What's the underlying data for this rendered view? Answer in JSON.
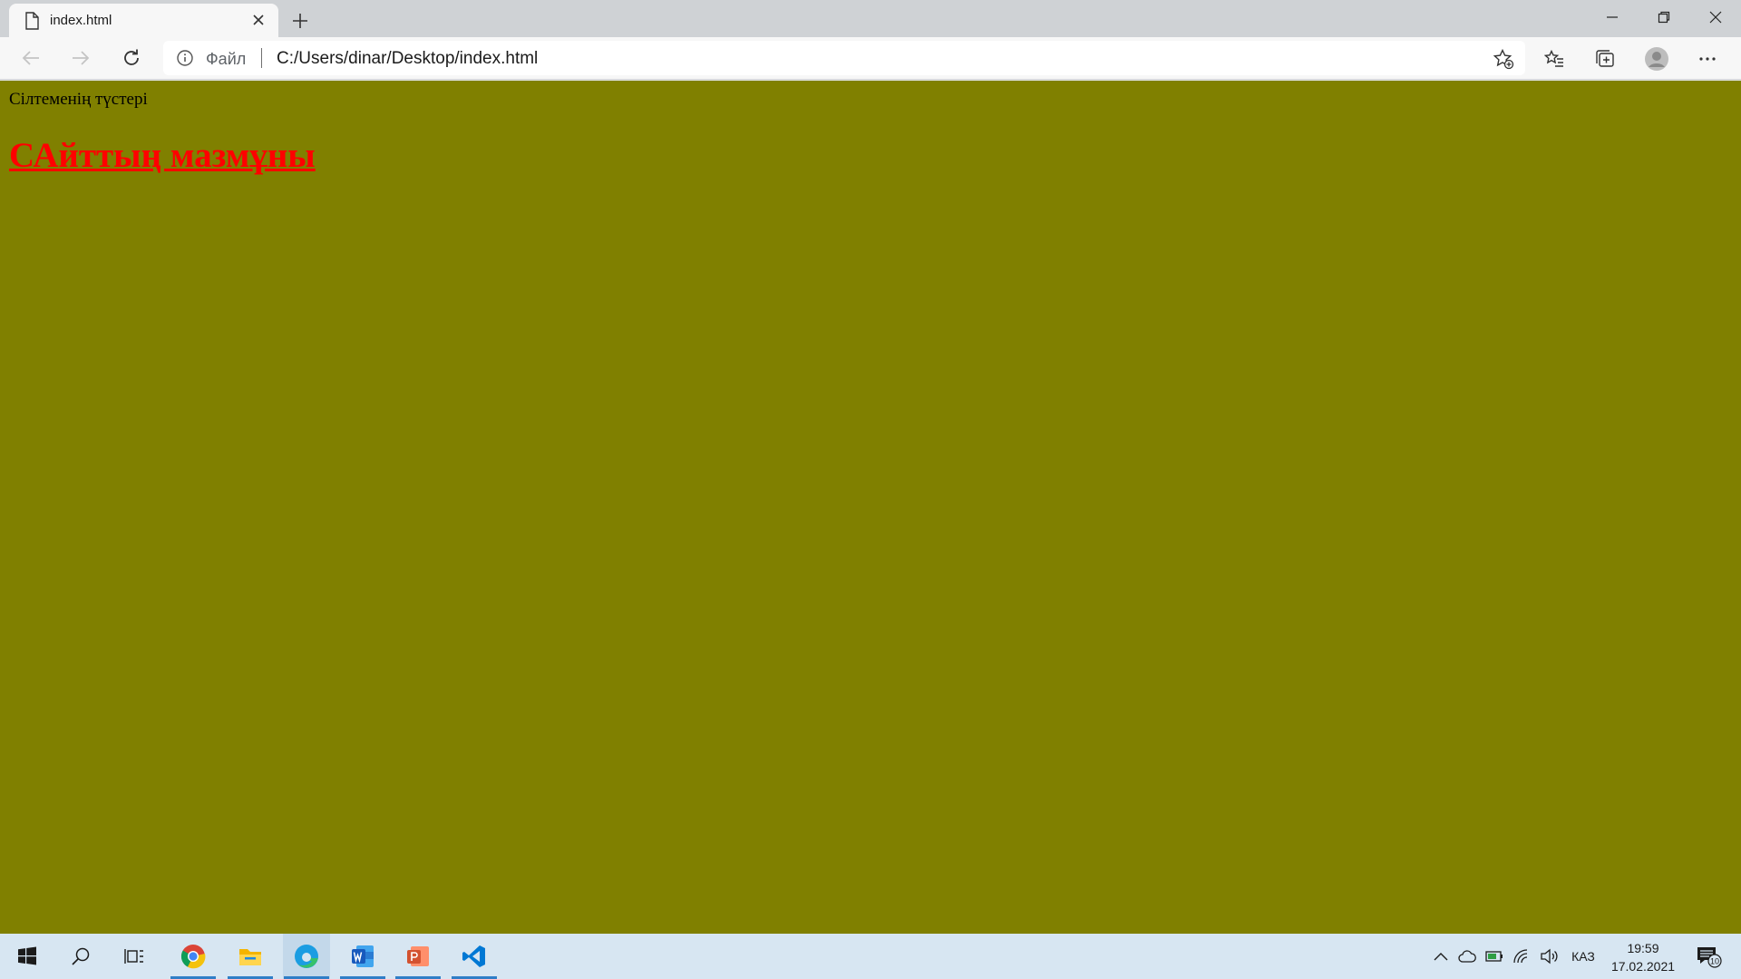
{
  "browser": {
    "tab_title": "index.html",
    "url_scheme_label": "Файл",
    "url": "C:/Users/dinar/Desktop/index.html"
  },
  "page": {
    "background_color": "#808000",
    "paragraph": "Сілтеменің түстері",
    "heading_link": "САйттың мазмұны",
    "link_color": "#ff0000"
  },
  "taskbar": {
    "apps": [
      "start-icon",
      "search-icon",
      "task-view-icon",
      "chrome-icon",
      "file-explorer-icon",
      "edge-icon",
      "word-icon",
      "powerpoint-icon",
      "vscode-icon"
    ],
    "language": "КАЗ",
    "time": "19:59",
    "date": "17.02.2021",
    "notification_count": "10"
  }
}
